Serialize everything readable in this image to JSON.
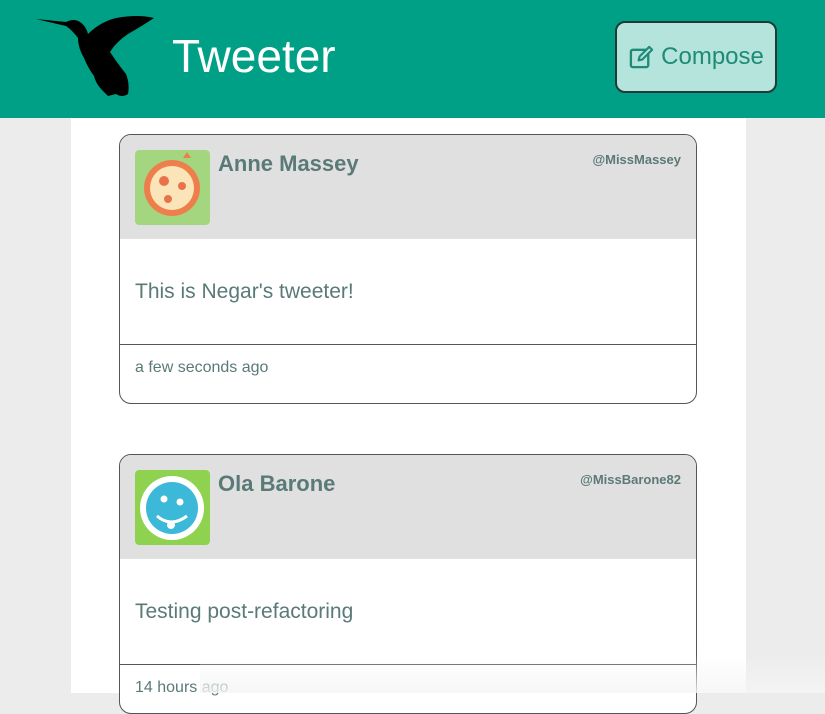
{
  "nav": {
    "brand": "Tweeter",
    "compose_label": "Compose",
    "logo_icon": "hummingbird-icon",
    "compose_icon": "pencil-square-icon",
    "bg_color": "#00a087"
  },
  "tweets": [
    {
      "name": "Anne Massey",
      "handle": "@MissMassey",
      "content": "This is Negar's tweeter!",
      "timestamp": "a few seconds ago",
      "avatar_icon": "tomato-face-avatar"
    },
    {
      "name": "Ola Barone",
      "handle": "@MissBarone82",
      "content": "Testing post-refactoring",
      "timestamp": "14 hours ago",
      "avatar_icon": "blue-face-avatar"
    }
  ]
}
